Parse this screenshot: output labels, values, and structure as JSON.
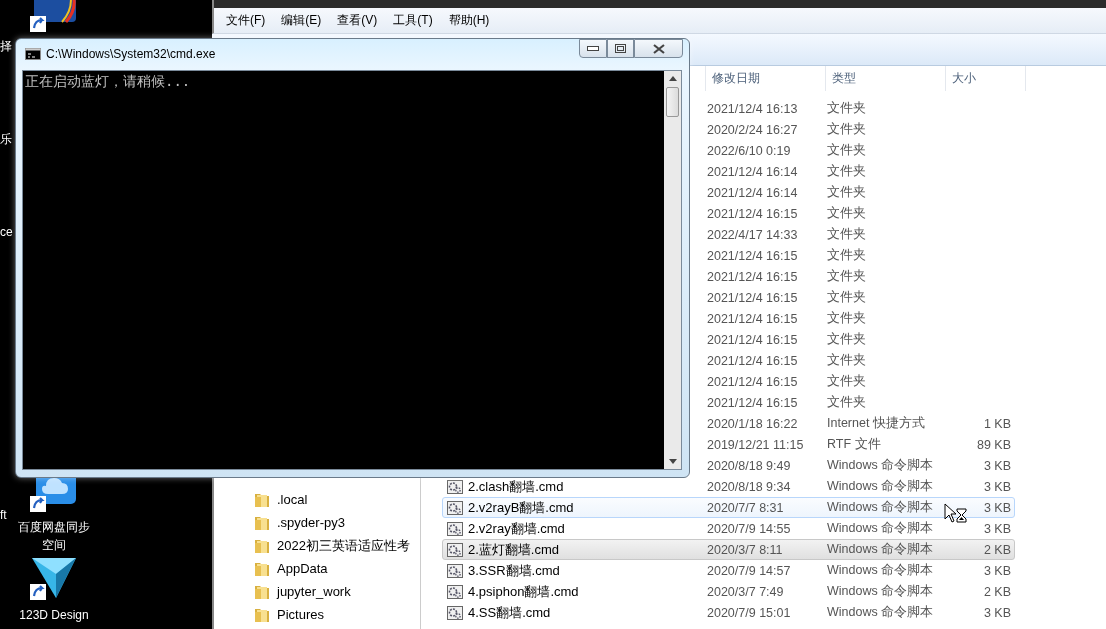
{
  "desktop": {
    "edge_labels": [
      {
        "text": "择"
      },
      {
        "text": "乐"
      },
      {
        "text": "ce"
      },
      {
        "text": "ft"
      }
    ],
    "icons": [
      {
        "kind": "sinosure"
      },
      {
        "kind": "cloud",
        "label": "百度网盘同步空间"
      },
      {
        "kind": "triangle",
        "label": "123D Design"
      }
    ]
  },
  "explorer": {
    "menu": [
      "文件(F)",
      "编辑(E)",
      "查看(V)",
      "工具(T)",
      "帮助(H)"
    ],
    "columns": [
      "修改日期",
      "类型",
      "大小"
    ],
    "nav_items": [
      ".local",
      ".spyder-py3",
      "2022初三英语适应性考",
      "AppData",
      "jupyter_work",
      "Pictures"
    ],
    "rows": [
      {
        "date": "2021/12/4 16:13",
        "type": "文件夹",
        "selected": false,
        "hovered": false
      },
      {
        "date": "2020/2/24 16:27",
        "type": "文件夹",
        "selected": false,
        "hovered": false
      },
      {
        "date": "2022/6/10 0:19",
        "type": "文件夹",
        "selected": false,
        "hovered": false
      },
      {
        "date": "2021/12/4 16:14",
        "type": "文件夹",
        "selected": false,
        "hovered": false
      },
      {
        "date": "2021/12/4 16:14",
        "type": "文件夹",
        "selected": false,
        "hovered": false
      },
      {
        "date": "2021/12/4 16:15",
        "type": "文件夹",
        "selected": false,
        "hovered": false
      },
      {
        "date": "2022/4/17 14:33",
        "type": "文件夹",
        "selected": false,
        "hovered": false
      },
      {
        "date": "2021/12/4 16:15",
        "type": "文件夹",
        "selected": false,
        "hovered": false
      },
      {
        "date": "2021/12/4 16:15",
        "type": "文件夹",
        "selected": false,
        "hovered": false
      },
      {
        "date": "2021/12/4 16:15",
        "type": "文件夹",
        "selected": false,
        "hovered": false
      },
      {
        "date": "2021/12/4 16:15",
        "type": "文件夹",
        "selected": false,
        "hovered": false
      },
      {
        "date": "2021/12/4 16:15",
        "type": "文件夹",
        "selected": false,
        "hovered": false
      },
      {
        "date": "2021/12/4 16:15",
        "type": "文件夹",
        "selected": false,
        "hovered": false
      },
      {
        "date": "2021/12/4 16:15",
        "type": "文件夹",
        "selected": false,
        "hovered": false
      },
      {
        "date": "2021/12/4 16:15",
        "type": "文件夹",
        "selected": false,
        "hovered": false
      },
      {
        "date": "2020/1/18 16:22",
        "type": "Internet 快捷方式",
        "size": "1 KB",
        "selected": false,
        "hovered": false
      },
      {
        "date": "2019/12/21 11:15",
        "type": "RTF 文件",
        "size": "89 KB",
        "selected": false,
        "hovered": false
      },
      {
        "date": "2020/8/18 9:49",
        "type": "Windows 命令脚本",
        "size": "3 KB",
        "selected": false,
        "hovered": false
      },
      {
        "name": "2.clash翻墙.cmd",
        "date": "2020/8/18 9:34",
        "type": "Windows 命令脚本",
        "size": "3 KB",
        "selected": false,
        "hovered": false
      },
      {
        "name": "2.v2rayB翻墙.cmd",
        "date": "2020/7/7 8:31",
        "type": "Windows 命令脚本",
        "size": "3 KB",
        "selected": false,
        "hovered": true
      },
      {
        "name": "2.v2ray翻墙.cmd",
        "date": "2020/7/9 14:55",
        "type": "Windows 命令脚本",
        "size": "3 KB",
        "selected": false,
        "hovered": false
      },
      {
        "name": "2.蓝灯翻墙.cmd",
        "date": "2020/3/7 8:11",
        "type": "Windows 命令脚本",
        "size": "2 KB",
        "selected": true,
        "hovered": false
      },
      {
        "name": "3.SSR翻墙.cmd",
        "date": "2020/7/9 14:57",
        "type": "Windows 命令脚本",
        "size": "3 KB",
        "selected": false,
        "hovered": false
      },
      {
        "name": "4.psiphon翻墙.cmd",
        "date": "2020/3/7 7:49",
        "type": "Windows 命令脚本",
        "size": "2 KB",
        "selected": false,
        "hovered": false
      },
      {
        "name": "4.SS翻墙.cmd",
        "date": "2020/7/9 15:01",
        "type": "Windows 命令脚本",
        "size": "3 KB",
        "selected": false,
        "hovered": false
      }
    ]
  },
  "console": {
    "title": "C:\\Windows\\System32\\cmd.exe",
    "lines": [
      "正在启动蓝灯，请稍候..."
    ]
  }
}
